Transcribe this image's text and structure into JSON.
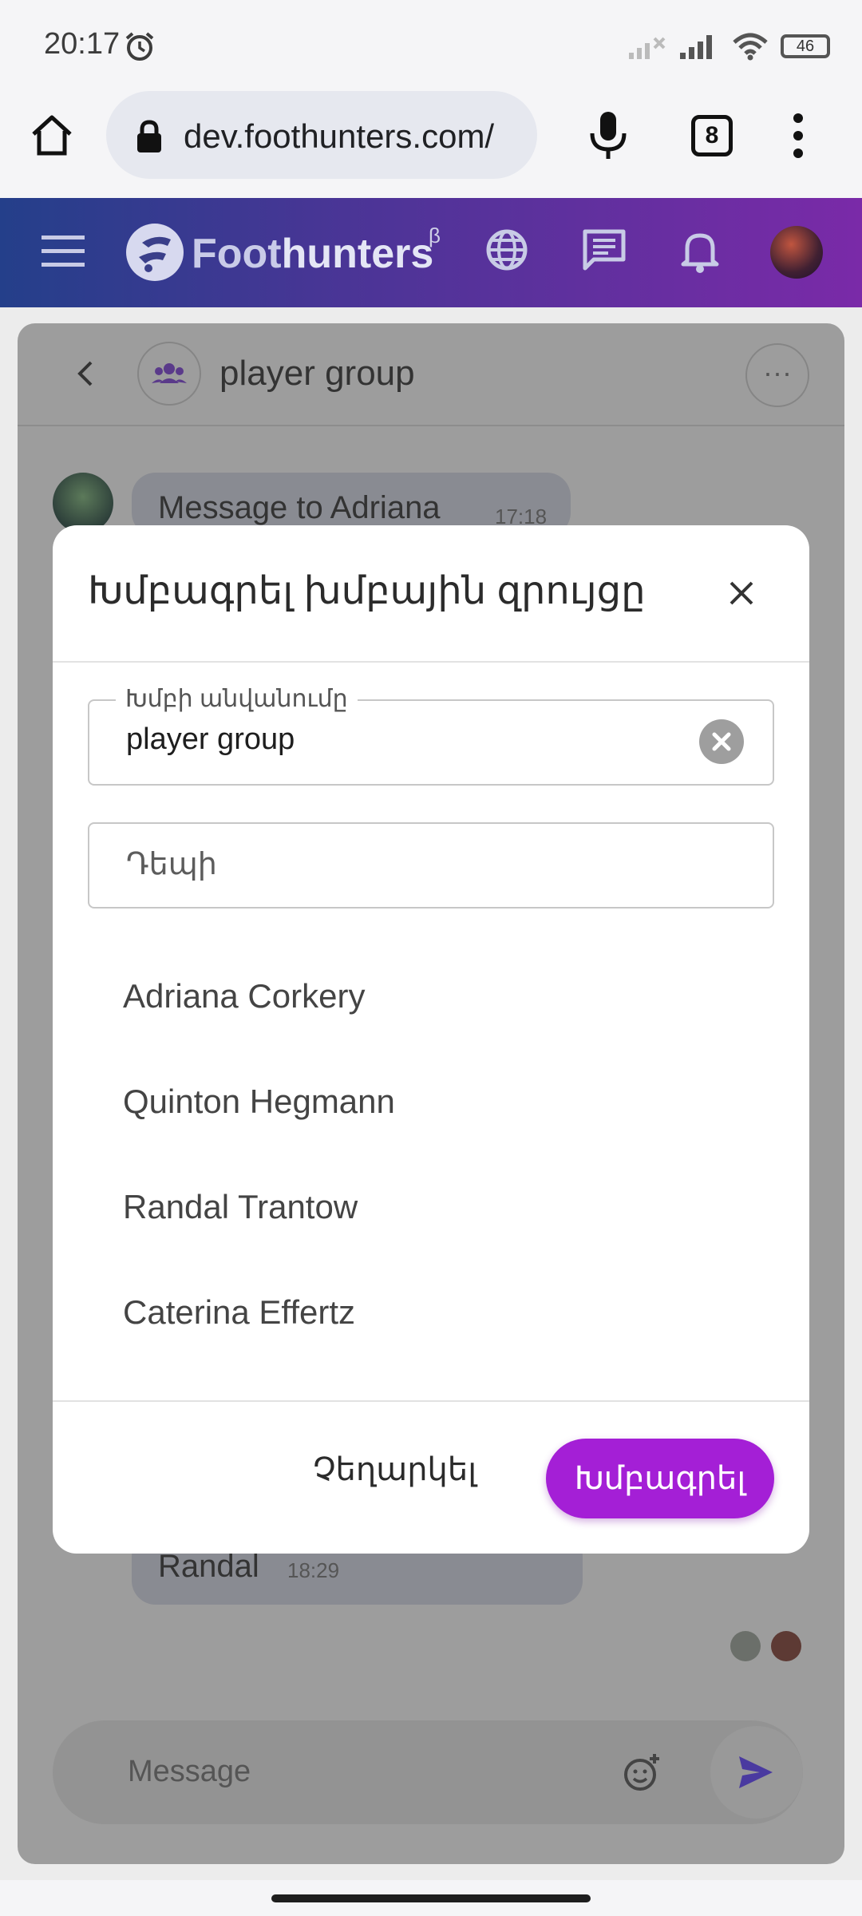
{
  "status_bar": {
    "time": "20:17",
    "battery": "46"
  },
  "browser": {
    "url": "dev.foothunters.com/",
    "tab_count": "8"
  },
  "app_header": {
    "brand_bold": "Foot",
    "brand_rest": "hunters",
    "beta": "β"
  },
  "chat": {
    "group_name": "player group",
    "more_label": "···",
    "messages": [
      {
        "text": "Message to Adriana",
        "time": "17:18"
      },
      {
        "text": "Randal",
        "time": "18:29"
      }
    ],
    "composer_placeholder": "Message"
  },
  "modal": {
    "title": "Խմբագրել խմբային զրույցը",
    "group_name_label": "Խմբի անվանումը",
    "group_name_value": "player group",
    "to_placeholder": "Դեպի",
    "members": [
      "Adriana Corkery",
      "Quinton Hegmann",
      "Randal Trantow",
      "Caterina Effertz"
    ],
    "cancel_label": "Չեղարկել",
    "save_label": "Խմբագրել"
  },
  "colors": {
    "accent": "#a41fd6",
    "header_start": "#243f8a",
    "header_end": "#7a2aa8"
  }
}
